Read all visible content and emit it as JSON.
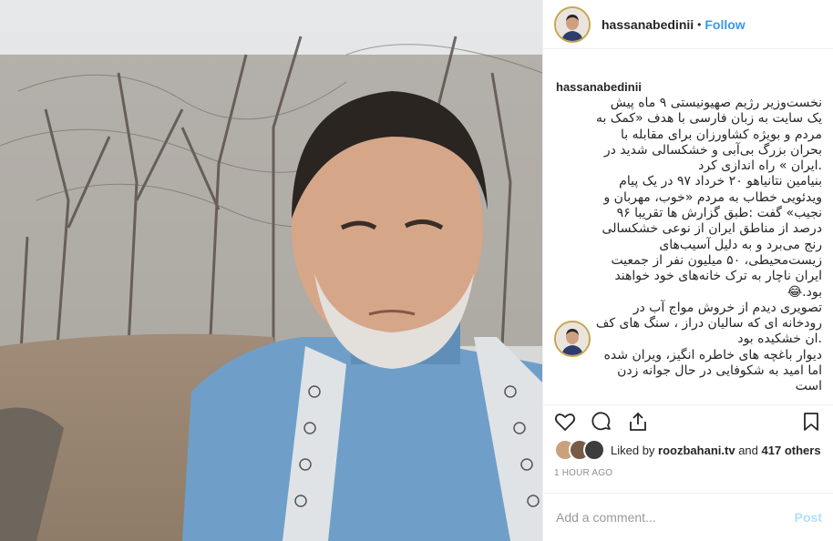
{
  "header": {
    "username": "hassanabedinii",
    "separator": "•",
    "follow_label": "Follow"
  },
  "caption": {
    "username": "hassanabedinii",
    "lines": [
      "نخست‌وزیر رژیم صهیونیستی ۹ ماه پیش",
      "یک سایت به زبان فارسی با هدف «کمک به",
      "مردم و بویژه کشاورزان برای مقابله با",
      "بحران بزرگ بی‌آبی و خشکسالی شدید در",
      ".ایران » راه اندازی کرد",
      "بنیامین نتانیاهو ۲۰ خرداد ۹۷ در یک پیام",
      "ویدئویی خطاب به مردم «خوب، مهربان و",
      "نجیب» گفت :طبق گزارش ها تقریبا ۹۶",
      "درصد از مناطق ایران از نوعی خشکسالی",
      "رنج می‌برد و به دلیل آسیب‌های",
      "زیست‌محیطی، ۵۰ میلیون نفر از جمعیت",
      "ایران ناچار به ترک خانه‌های خود خواهند",
      "بود.😂"
    ]
  },
  "comment": {
    "lines": [
      "تصویری دیدم از خروش مواج آب در",
      "رودخانه ای که سالیان دراز ، سنگ های کف",
      ".ان خشکیده بود",
      "دیوار باغچه های خاطره انگیز، ویران شده",
      "اما امید به شکوفایی در حال جوانه زدن",
      "است"
    ]
  },
  "actions": {
    "like_icon": "heart-icon",
    "comment_icon": "comment-icon",
    "share_icon": "share-icon",
    "save_icon": "bookmark-icon"
  },
  "likes": {
    "prefix": "Liked by",
    "user": "roozbahani.tv",
    "middle": "and",
    "others": "417 others"
  },
  "timestamp": "1 HOUR AGO",
  "add_comment": {
    "placeholder": "Add a comment...",
    "post_label": "Post"
  },
  "colors": {
    "follow": "#3897f0",
    "post_disabled": "#b2dffc",
    "timestamp": "#8e8e8e",
    "border": "#efefef",
    "story_ring": "#c9a64d"
  }
}
